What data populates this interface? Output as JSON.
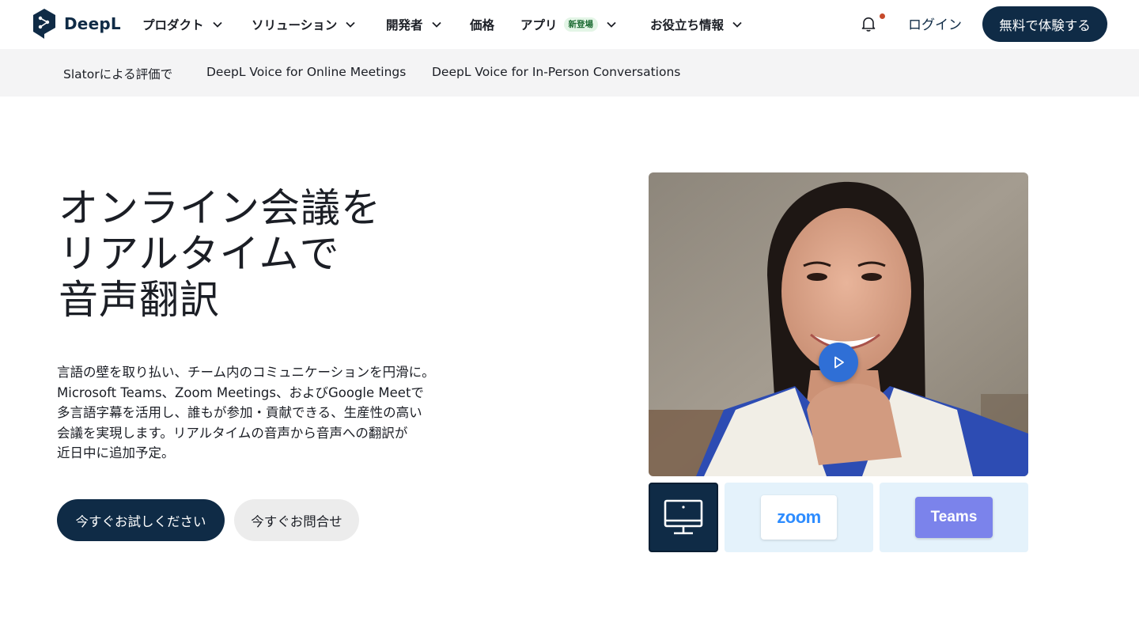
{
  "brand": {
    "name": "DeepL",
    "color": "#0f2b46"
  },
  "nav": {
    "items": [
      {
        "label": "プロダクト",
        "has_dropdown": true
      },
      {
        "label": "ソリューション",
        "has_dropdown": true
      },
      {
        "label": "開発者",
        "has_dropdown": true
      },
      {
        "label": "価格",
        "has_dropdown": false
      },
      {
        "label": "アプリ",
        "badge": "新登場",
        "has_dropdown": true
      },
      {
        "label": "お役立ち情報",
        "has_dropdown": true
      }
    ],
    "notification_icon": "bell-icon",
    "notification_dot_color": "#c64a2b",
    "login_label": "ログイン",
    "cta_label": "無料で体験する"
  },
  "subnav": {
    "links": [
      "Slatorによる評価で",
      "DeepL Voice for Online Meetings",
      "DeepL Voice for In-Person Conversations"
    ]
  },
  "hero": {
    "title_lines": [
      "オンライン会議を",
      "リアルタイムで",
      "音声翻訳"
    ],
    "body_lines": [
      "言語の壁を取り払い、チーム内のコミュニケーションを円滑に。",
      "Microsoft Teams、Zoom Meetings、およびGoogle Meetで",
      "多言語字幕を活用し、誰もが参加・貢献できる、生産性の高い",
      "会議を実現します。リアルタイムの音声から音声への翻訳が",
      "近日中に追加予定。"
    ],
    "primary_button": "今すぐお試しください",
    "secondary_button": "今すぐお問合せ"
  },
  "media": {
    "video_play_icon": "play-icon",
    "tiles": [
      {
        "name": "desktop",
        "icon": "desktop-monitor-icon",
        "selected": true
      },
      {
        "name": "zoom",
        "label": "zoom"
      },
      {
        "name": "teams",
        "label": "Teams"
      }
    ]
  }
}
